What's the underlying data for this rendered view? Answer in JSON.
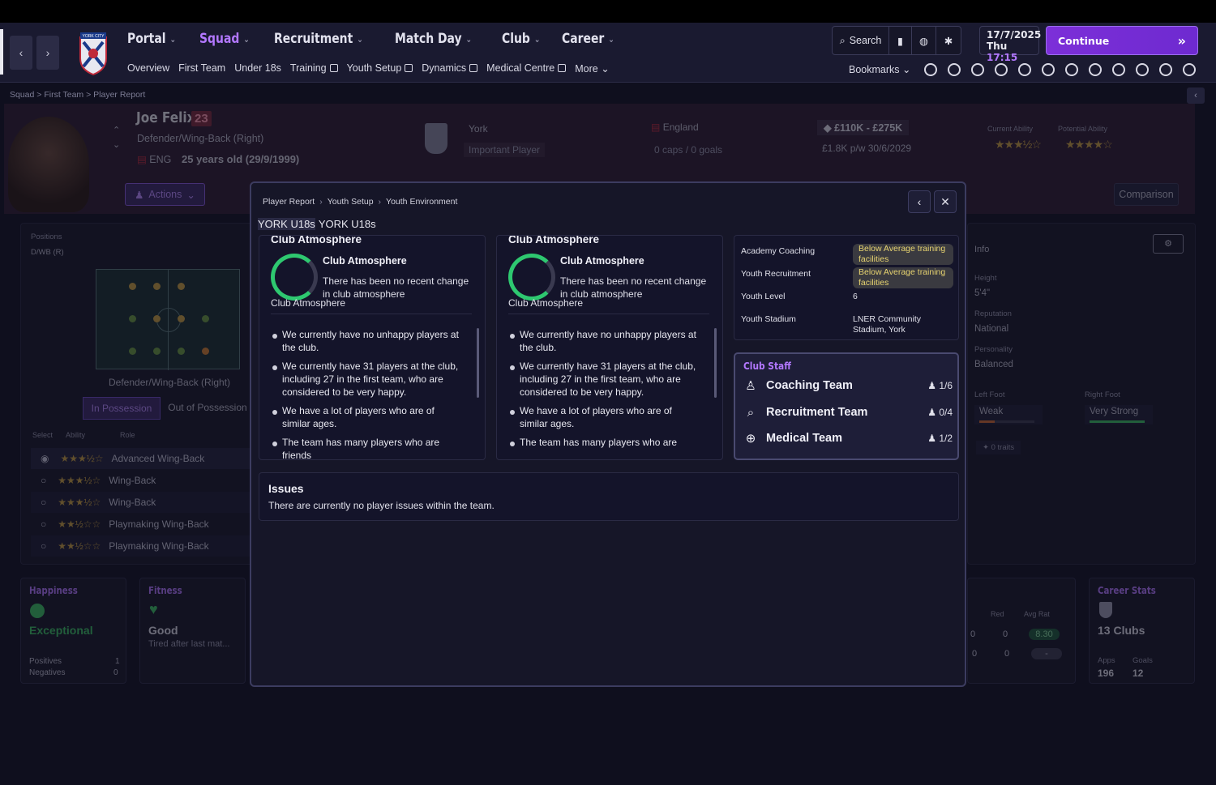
{
  "header": {
    "nav": [
      {
        "label": "Portal",
        "active": false
      },
      {
        "label": "Squad",
        "active": true
      },
      {
        "label": "Recruitment",
        "active": false
      },
      {
        "label": "Match Day",
        "active": false
      },
      {
        "label": "Club",
        "active": false
      },
      {
        "label": "Career",
        "active": false
      }
    ],
    "subnav": [
      "Overview",
      "First Team",
      "Under 18s",
      "Training",
      "Youth Setup",
      "Dynamics",
      "Medical Centre",
      "More"
    ],
    "search_label": "Search",
    "date": "17/7/2025",
    "day": "Thu",
    "time": "17:15",
    "continue_label": "Continue",
    "bookmarks_label": "Bookmarks",
    "crest_text": "YORK CITY"
  },
  "breadcrumb": [
    "Squad",
    "First Team",
    "Player Report"
  ],
  "player": {
    "name": "Joe Felix",
    "number": "23",
    "position": "Defender/Wing-Back (Right)",
    "nationality": "ENG",
    "age": "25 years old (29/9/1999)",
    "actions_label": "Actions",
    "club": "York",
    "status": "Important Player",
    "country": "England",
    "caps": "0 caps / 0 goals",
    "value": "£110K - £275K",
    "wage": "£1.8K p/w 30/6/2029",
    "current_ability_label": "Current Ability",
    "potential_ability_label": "Potential Ability",
    "comparison_label": "Comparison"
  },
  "left_panel": {
    "positions_label": "Positions",
    "positions_value": "D/WB (R)",
    "role_label": "Defender/Wing-Back (Right)",
    "in_possession": "In Possession",
    "out_of_possession": "Out of Possession",
    "cols": [
      "Select",
      "Ability",
      "Role"
    ],
    "roles": [
      "Advanced Wing-Back",
      "Wing-Back",
      "Wing-Back",
      "Playmaking Wing-Back",
      "Playmaking Wing-Back"
    ]
  },
  "right_panel": {
    "info_label": "Info",
    "height_label": "Height",
    "height": "5'4\"",
    "reputation_label": "Reputation",
    "reputation": "National",
    "personality_label": "Personality",
    "personality": "Balanced",
    "left_foot_label": "Left Foot",
    "left_foot": "Weak",
    "right_foot_label": "Right Foot",
    "right_foot": "Very Strong",
    "traits": "0 traits"
  },
  "cards": {
    "happiness_title": "Happiness",
    "happiness_value": "Exceptional",
    "positives_label": "Positives",
    "positives": "1",
    "negatives_label": "Negatives",
    "negatives": "0",
    "fitness_title": "Fitness",
    "fitness_value": "Good",
    "fitness_note": "Tired after last mat...",
    "stats_red_label": "Red",
    "stats_avg_label": "Avg Rat",
    "stats_row1": [
      "0",
      "0",
      "8.30"
    ],
    "stats_row2": [
      "0",
      "0",
      "-"
    ],
    "career_title": "Career Stats",
    "career_clubs": "13 Clubs",
    "apps_label": "Apps",
    "apps": "196",
    "goals_label": "Goals",
    "goals": "12"
  },
  "modal": {
    "breadcrumb": [
      "Player Report",
      "Youth Setup",
      "Youth Environment"
    ],
    "tabs": [
      "YORK U18s",
      "YORK U18s"
    ],
    "atmosphere_cards": [
      {
        "title": "Club Atmosphere",
        "subtitle": "Club Atmosphere",
        "description": "There has been no recent change in club atmosphere",
        "ring_label": "Club Atmosphere",
        "bullets": [
          "We currently have no unhappy players at the club.",
          "We currently have 31 players at the club, including 27 in the first team, who are considered to be very happy.",
          "We have a lot of players who are of similar ages.",
          "The team has many players who are friends"
        ]
      },
      {
        "title": "Club Atmosphere",
        "subtitle": "Club Atmosphere",
        "description": "There has been no recent change in club atmosphere",
        "ring_label": "Club Atmosphere",
        "bullets": [
          "We currently have no unhappy players at the club.",
          "We currently have 31 players at the club, including 27 in the first team, who are considered to be very happy.",
          "We have a lot of players who are of similar ages.",
          "The team has many players who are"
        ]
      }
    ],
    "facilities": [
      {
        "label": "Academy Coaching",
        "value": "Below Average training facilities"
      },
      {
        "label": "Youth Recruitment",
        "value": "Below Average training facilities"
      },
      {
        "label": "Youth Level",
        "value": "6"
      },
      {
        "label": "Youth Stadium",
        "value": "LNER Community Stadium, York"
      }
    ],
    "staff_title": "Club Staff",
    "staff": [
      {
        "label": "Coaching Team",
        "count": "1/6",
        "icon": "whistle-icon"
      },
      {
        "label": "Recruitment Team",
        "count": "0/4",
        "icon": "magnifier-icon"
      },
      {
        "label": "Medical Team",
        "count": "1/2",
        "icon": "medical-cross-icon"
      }
    ],
    "issues_title": "Issues",
    "issues_text": "There are currently no player issues within the team."
  },
  "colors": {
    "accent": "#b378ff",
    "ring": "#2ec870",
    "badge_text": "#e8d470"
  }
}
